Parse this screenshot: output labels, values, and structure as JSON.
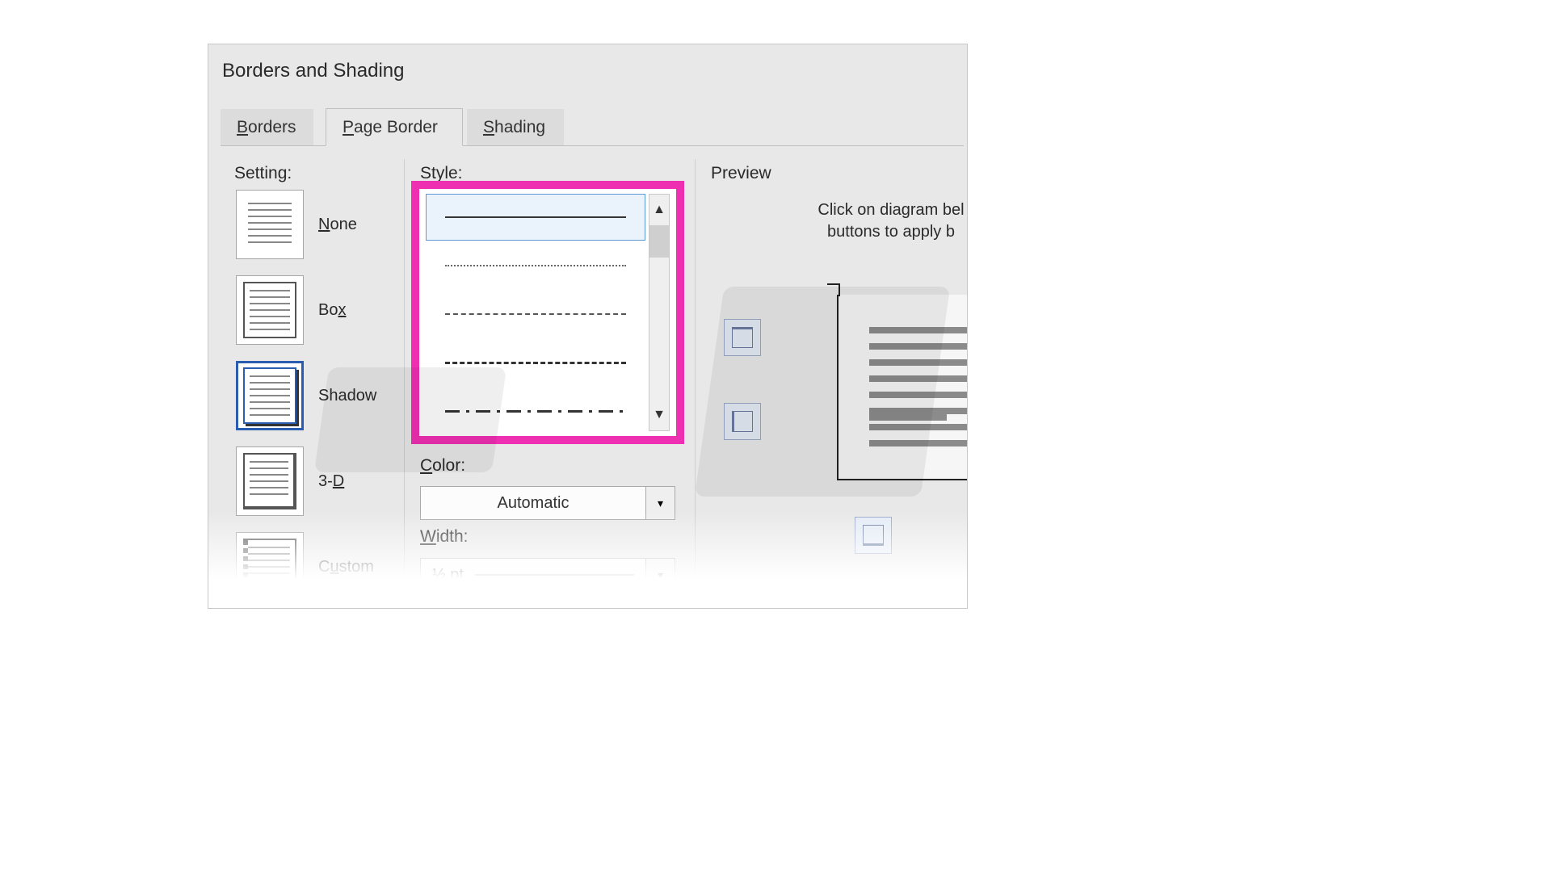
{
  "dialog": {
    "title": "Borders and Shading"
  },
  "tabs": {
    "borders": {
      "prefix": "B",
      "rest": "orders"
    },
    "page": {
      "prefix": "P",
      "rest": "age Border"
    },
    "shading": {
      "prefix": "S",
      "rest": "hading"
    },
    "active": "page"
  },
  "labels": {
    "setting": "Setting:",
    "style": "Style:",
    "color_prefix": "C",
    "color_rest": "olor:",
    "width": "Width:",
    "width_underline": "W",
    "preview": "Preview",
    "preview_hint_l1": "Click on diagram bel",
    "preview_hint_l2": "buttons to apply b"
  },
  "settings": [
    {
      "key": "none",
      "ul": "N",
      "rest": "one"
    },
    {
      "key": "box",
      "ul": "",
      "rest": "Bo",
      "ul2": "x"
    },
    {
      "key": "shadow",
      "ul": "",
      "rest": "Shadow"
    },
    {
      "key": "3d",
      "ul": "",
      "rest": "3-",
      "ul2": "D"
    },
    {
      "key": "custom",
      "ul": "",
      "rest": "C",
      "ul2": "u",
      "rest2": "stom"
    }
  ],
  "setting_selected": "shadow",
  "styles": {
    "items": [
      "solid",
      "dotted",
      "dashed",
      "dashed-heavy",
      "dash-dot"
    ],
    "selected_index": 0
  },
  "color": {
    "value": "Automatic"
  },
  "width": {
    "value": "½ pt"
  },
  "highlight_color": "#ef2fb2"
}
